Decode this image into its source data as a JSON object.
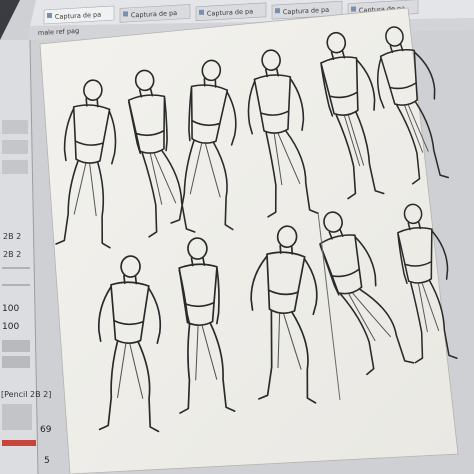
{
  "app": {
    "tabs": [
      {
        "label": "Captura de pa"
      },
      {
        "label": "Captura de pa"
      },
      {
        "label": "Captura de pa"
      },
      {
        "label": "Captura de pa"
      },
      {
        "label": "Captura de pa"
      }
    ],
    "subtitle": "male ref pag"
  },
  "tool_panel": {
    "brush_sizes": [
      "2B 2",
      "2B 2"
    ],
    "opacity_values": [
      "100",
      "100"
    ],
    "layer_name": "[Pencil 2B 2]",
    "slider_value": "69",
    "bottom_value": "5"
  },
  "colors": {
    "desk": "#2b2d31",
    "monitor_bezel": "#1c1d21",
    "app_bg": "#d9dadc",
    "canvas": "#f4f3ef",
    "ink": "#2a2a2a",
    "accent_red": "#c8453c"
  },
  "canvas_content": {
    "figure_count": 12,
    "icons": [
      "figure-sketch"
    ]
  }
}
